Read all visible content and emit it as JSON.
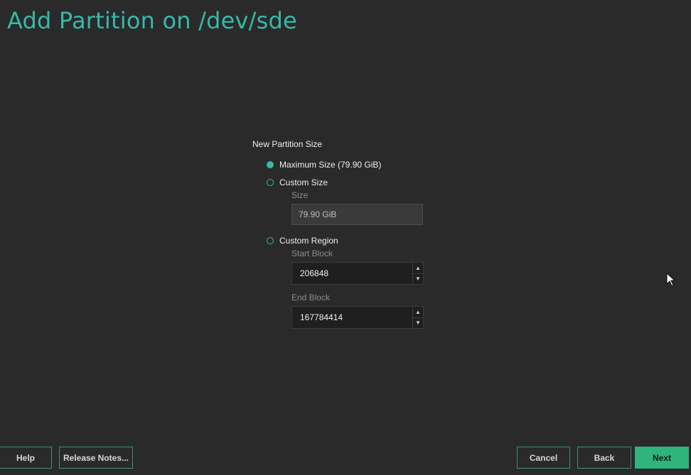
{
  "window": {
    "title": "Add Partition on /dev/sde"
  },
  "form": {
    "group_label": "New Partition Size",
    "options": [
      {
        "label": "Maximum Size (79.90 GiB)",
        "selected": true
      },
      {
        "label": "Custom Size",
        "selected": false
      },
      {
        "label": "Custom Region",
        "selected": false
      }
    ],
    "size": {
      "label": "Size",
      "value": "79.90 GiB"
    },
    "start_block": {
      "label": "Start Block",
      "value": "206848"
    },
    "end_block": {
      "label": "End Block",
      "value": "167784414"
    }
  },
  "footer": {
    "help": "Help",
    "release_notes": "Release Notes...",
    "cancel": "Cancel",
    "back": "Back",
    "next": "Next"
  },
  "icons": {
    "spin_up": "spin-up-arrow-icon",
    "spin_down": "spin-down-arrow-icon",
    "cursor": "mouse-pointer-icon"
  },
  "colors": {
    "accent": "#35b9ab",
    "primary_button": "#2fb47c",
    "background": "#2a2a2a"
  }
}
